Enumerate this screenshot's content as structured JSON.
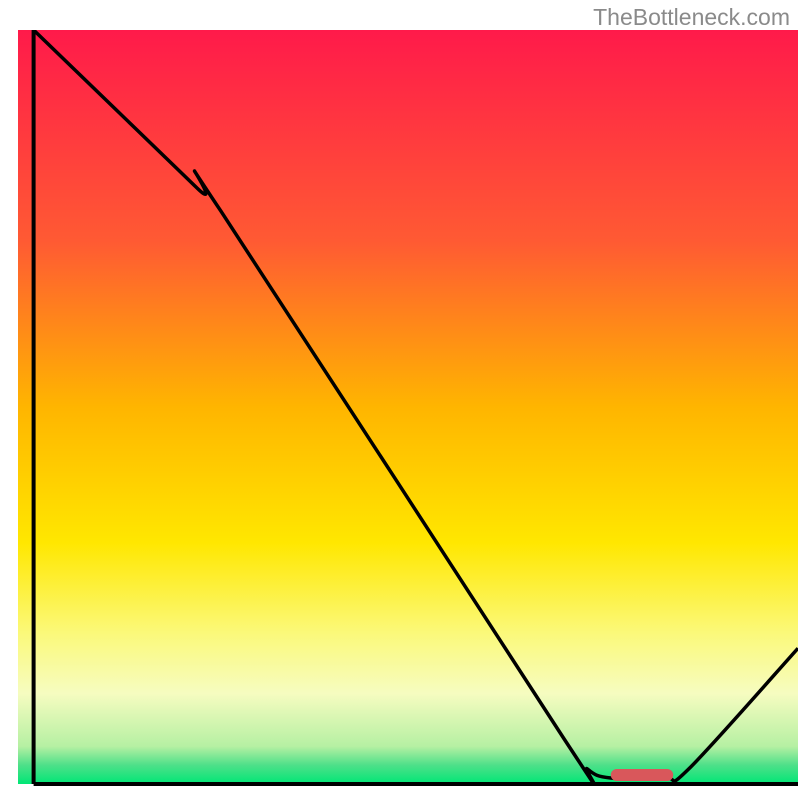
{
  "watermark": "TheBottleneck.com",
  "chart_data": {
    "type": "line",
    "title": "",
    "xlabel": "",
    "ylabel": "",
    "xlim": [
      0,
      100
    ],
    "ylim": [
      0,
      100
    ],
    "gradient_stops": [
      {
        "offset": 0.0,
        "color": "#ff1a4a"
      },
      {
        "offset": 0.28,
        "color": "#ff5a33"
      },
      {
        "offset": 0.5,
        "color": "#ffb500"
      },
      {
        "offset": 0.68,
        "color": "#ffe700"
      },
      {
        "offset": 0.8,
        "color": "#fbf97a"
      },
      {
        "offset": 0.88,
        "color": "#f6fcc0"
      },
      {
        "offset": 0.95,
        "color": "#b6f0a3"
      },
      {
        "offset": 0.975,
        "color": "#4ee089"
      },
      {
        "offset": 1.0,
        "color": "#00e676"
      }
    ],
    "curve_points": [
      {
        "x": 2,
        "y": 100
      },
      {
        "x": 23,
        "y": 79
      },
      {
        "x": 26,
        "y": 76
      },
      {
        "x": 70,
        "y": 6
      },
      {
        "x": 73,
        "y": 2
      },
      {
        "x": 76,
        "y": 0.8
      },
      {
        "x": 83,
        "y": 0.8
      },
      {
        "x": 86,
        "y": 2
      },
      {
        "x": 100,
        "y": 18
      }
    ],
    "marker": {
      "x_start": 76,
      "x_end": 84,
      "y": 1.2,
      "color": "#d9575b"
    },
    "axes": {
      "left": {
        "x": 2,
        "y1": 0,
        "y2": 100
      },
      "bottom": {
        "y": 0,
        "x1": 2,
        "x2": 100
      }
    }
  }
}
